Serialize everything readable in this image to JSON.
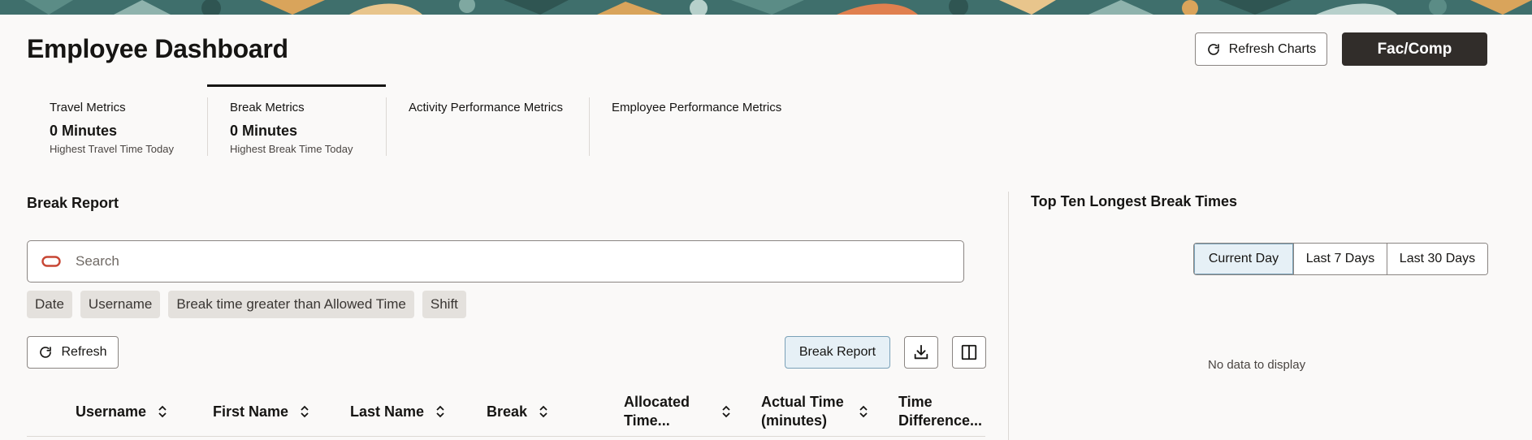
{
  "header": {
    "title": "Employee Dashboard",
    "refresh_charts_label": "Refresh Charts",
    "fac_comp_label": "Fac/Comp"
  },
  "metric_tabs": [
    {
      "label": "Travel Metrics",
      "value": "0 Minutes",
      "sub": "Highest Travel Time Today"
    },
    {
      "label": "Break Metrics",
      "value": "0 Minutes",
      "sub": "Highest Break Time Today",
      "active": true
    },
    {
      "label": "Activity Performance Metrics"
    },
    {
      "label": "Employee Performance Metrics"
    }
  ],
  "break_report": {
    "title": "Break Report",
    "search_placeholder": "Search",
    "filters": [
      "Date",
      "Username",
      "Break time greater than Allowed Time",
      "Shift"
    ],
    "refresh_label": "Refresh",
    "report_button_label": "Break Report",
    "columns": [
      "Username",
      "First Name",
      "Last Name",
      "Break",
      "Allocated Time...",
      "Actual Time (minutes)",
      "Time Difference..."
    ]
  },
  "top_ten": {
    "title": "Top Ten Longest Break Times",
    "ranges": [
      "Current Day",
      "Last 7 Days",
      "Last 30 Days"
    ],
    "selected_range": "Current Day",
    "empty_message": "No data to display"
  },
  "colors": {
    "banner": "#3f6f6c",
    "accent_dark": "#312d2a",
    "selected_bg": "#e6f0f6",
    "oracle_red": "#c74634"
  }
}
